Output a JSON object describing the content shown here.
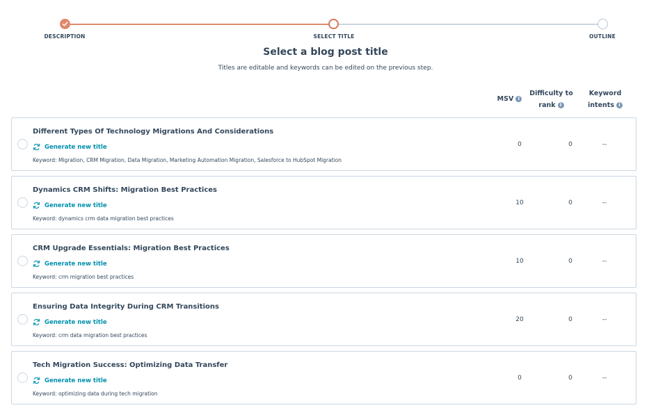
{
  "stepper": {
    "steps": [
      {
        "label": "DESCRIPTION",
        "state": "complete"
      },
      {
        "label": "SELECT TITLE",
        "state": "active"
      },
      {
        "label": "OUTLINE",
        "state": "pending"
      }
    ]
  },
  "heading": "Select a blog post title",
  "subheading": "Titles are editable and keywords can be edited on the previous step.",
  "columns": {
    "msv": "MSV",
    "difficulty_line1": "Difficulty to",
    "difficulty_line2": "rank",
    "intents_line1": "Keyword",
    "intents_line2": "intents"
  },
  "generate_label": "Generate new title",
  "titles": [
    {
      "title": "Different Types Of Technology Migrations And Considerations",
      "keyword": "Keyword: Migration, CRM Migration, Data Migration, Marketing Automation Migration, Salesforce to HubSpot Migration",
      "msv": "0",
      "difficulty": "0",
      "intents": "--"
    },
    {
      "title": "Dynamics CRM Shifts: Migration Best Practices",
      "keyword": "Keyword: dynamics crm data migration best practices",
      "msv": "10",
      "difficulty": "0",
      "intents": "--"
    },
    {
      "title": "CRM Upgrade Essentials: Migration Best Practices",
      "keyword": "Keyword: crm migration best practices",
      "msv": "10",
      "difficulty": "0",
      "intents": "--"
    },
    {
      "title": "Ensuring Data Integrity During CRM Transitions",
      "keyword": "Keyword: crm data migration best practices",
      "msv": "20",
      "difficulty": "0",
      "intents": "--"
    },
    {
      "title": "Tech Migration Success: Optimizing Data Transfer",
      "keyword": "Keyword: optimizing data during tech migration",
      "msv": "0",
      "difficulty": "0",
      "intents": "--"
    }
  ],
  "colors": {
    "accent": "#e0896c",
    "link": "#0091ae",
    "text": "#33475b",
    "border": "#cbd6e2"
  }
}
